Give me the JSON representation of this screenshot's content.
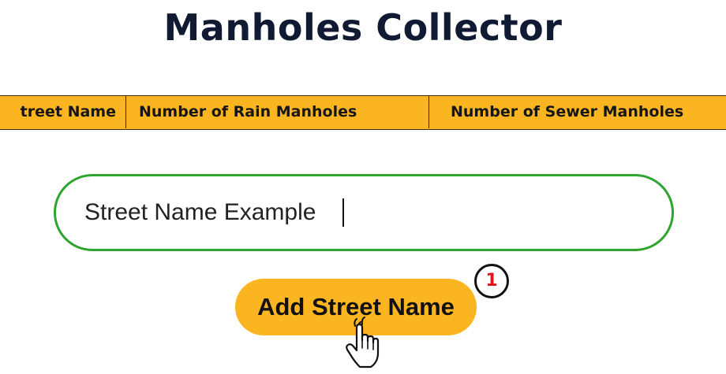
{
  "header": {
    "title": "Manholes Collector"
  },
  "table": {
    "columns": [
      "treet Name",
      "Number of Rain Manholes",
      "Number of Sewer Manholes"
    ]
  },
  "form": {
    "street_input_value": "Street Name Example",
    "add_button_label": "Add Street Name"
  },
  "annotation": {
    "step_number": "1",
    "cursor_icon": "hand-pointer-click-icon"
  },
  "colors": {
    "accent": "#fbb521",
    "input_border": "#2ea52e",
    "title": "#111a33",
    "badge_number": "#e0141c"
  }
}
